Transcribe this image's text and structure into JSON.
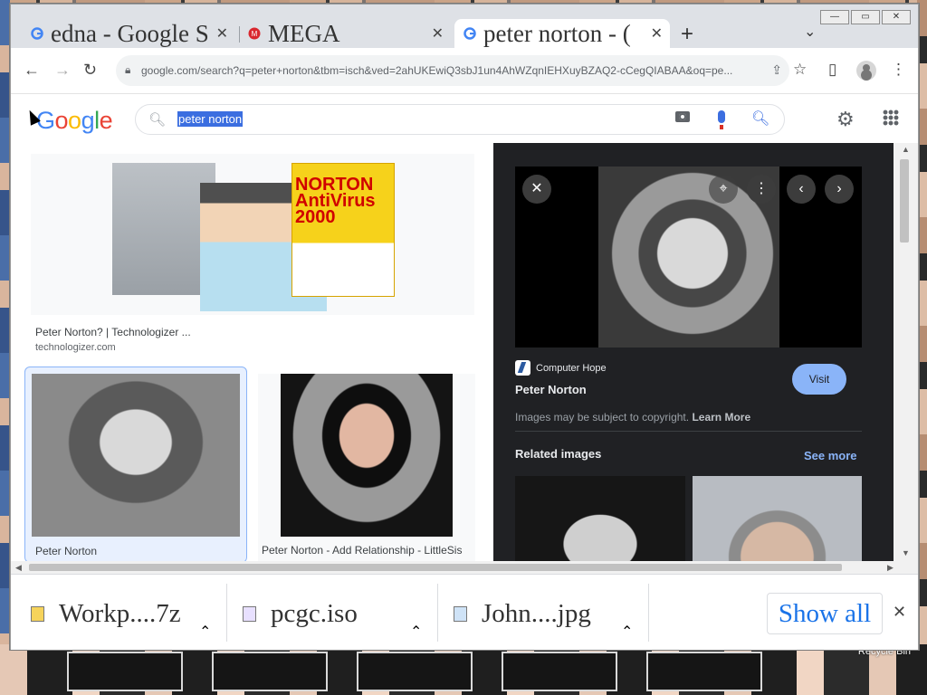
{
  "browser": {
    "tabs": [
      {
        "title": "edna - Google S",
        "favicon": "google-g-icon"
      },
      {
        "title": "MEGA",
        "favicon": "mega-icon"
      },
      {
        "title": "peter norton - (",
        "favicon": "google-g-icon"
      }
    ],
    "new_tab": "+",
    "tab_menu": "⌄",
    "close_glyph": "✕",
    "url": "google.com/search?q=peter+norton&tbm=isch&ved=2ahUKEwiQ3sbJ1un4AhWZqnIEHXuyBZAQ2-cCegQIABAA&oq=pe..."
  },
  "google": {
    "logo": [
      "G",
      "o",
      "o",
      "g",
      "l",
      "e"
    ],
    "logo_colors": [
      "#4285F4",
      "#EA4335",
      "#FBBC05",
      "#4285F4",
      "#34A853",
      "#EA4335"
    ],
    "query": "peter norton"
  },
  "results": [
    {
      "title": "Peter Norton? | Technologizer ...",
      "site": "technologizer.com",
      "magazine_text": "NORTON AntiVirus 2000"
    },
    {
      "title": "Peter Norton"
    },
    {
      "title": "Peter Norton - Add Relationship - LittleSis"
    }
  ],
  "preview": {
    "source": "Computer Hope",
    "title": "Peter Norton",
    "visit_label": "Visit",
    "copyright_text": "Images may be subject to copyright.",
    "learn_more": "Learn More",
    "related_label": "Related images",
    "see_more": "See more"
  },
  "downloads": [
    {
      "name": "Workp....7z",
      "icon": "archive-file-icon"
    },
    {
      "name": "pcgc.iso",
      "icon": "disc-image-file-icon"
    },
    {
      "name": "John....jpg",
      "icon": "image-file-icon"
    }
  ],
  "show_all": "Show all",
  "desktop": {
    "recycle_bin": "Recycle Bin"
  }
}
